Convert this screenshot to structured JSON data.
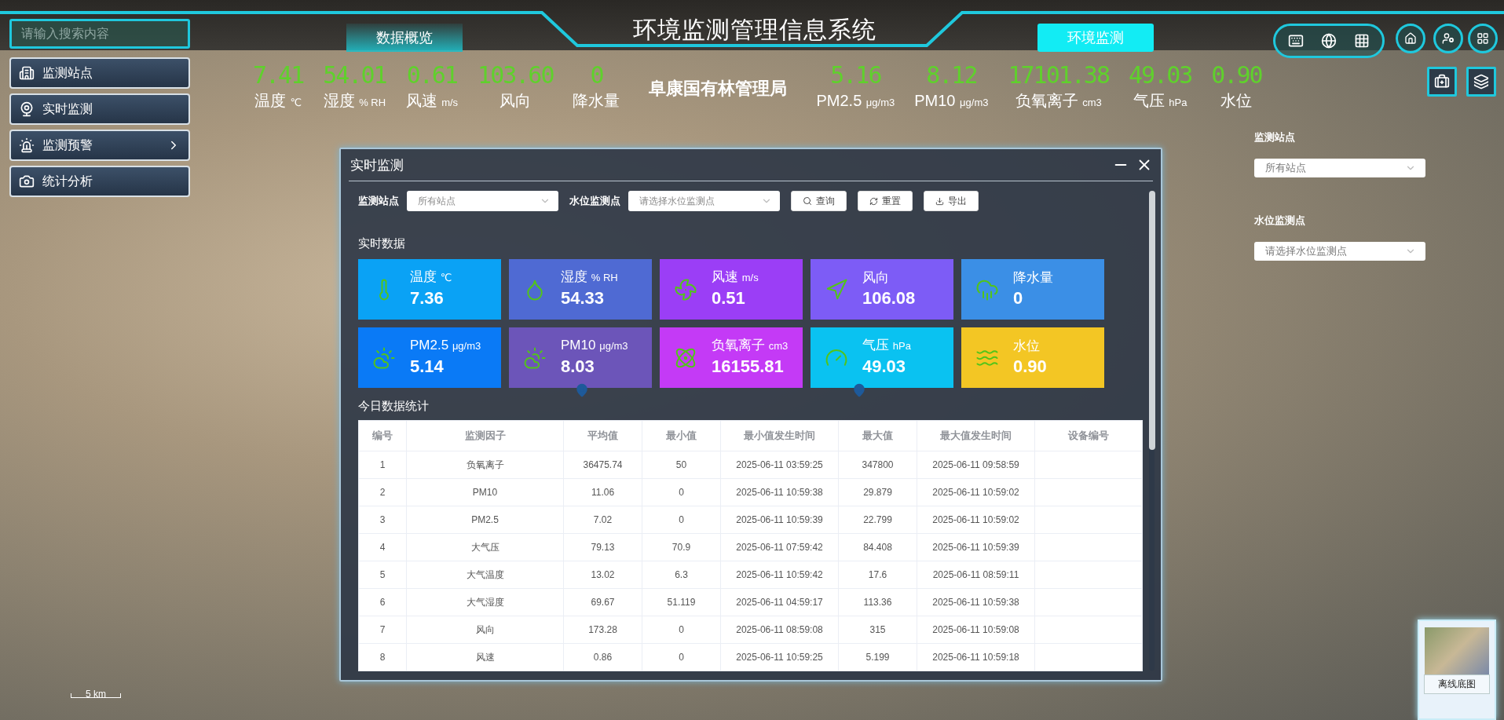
{
  "header": {
    "search": {
      "placeholder": "请输入搜索内容"
    },
    "title": "环境监测管理信息系统",
    "tabs": [
      {
        "label": "数据概览",
        "selected": false
      },
      {
        "label": "环境监测",
        "selected": true
      }
    ]
  },
  "side_menu": [
    {
      "label": "监测站点",
      "expandable": false
    },
    {
      "label": "实时监测",
      "expandable": false
    },
    {
      "label": "监测预警",
      "expandable": true
    },
    {
      "label": "统计分析",
      "expandable": false
    }
  ],
  "metrics_left": [
    {
      "value": "7.41",
      "name": "温度",
      "unit": "℃"
    },
    {
      "value": "54.01",
      "name": "湿度",
      "unit": "% RH"
    },
    {
      "value": "0.61",
      "name": "风速",
      "unit": "m/s"
    },
    {
      "value": "103.60",
      "name": "风向"
    },
    {
      "value": "0",
      "name": "降水量"
    }
  ],
  "organization": "阜康国有林管理局",
  "metrics_right": [
    {
      "value": "5.16",
      "name": "PM2.5",
      "unit": "μg/m3"
    },
    {
      "value": "8.12",
      "name": "PM10",
      "unit": "μg/m3"
    },
    {
      "value": "17101.38",
      "name": "负氧离子",
      "unit": "cm3"
    },
    {
      "value": "49.03",
      "name": "气压",
      "unit": "hPa"
    },
    {
      "value": "0.90",
      "name": "水位"
    }
  ],
  "right_panel": {
    "fields": [
      {
        "label": "监测站点",
        "placeholder": "所有站点"
      },
      {
        "label": "水位监测点",
        "placeholder": "请选择水位监测点"
      }
    ]
  },
  "dialog": {
    "title": "实时监测",
    "filters": [
      {
        "label": "监测站点",
        "placeholder": "所有站点"
      },
      {
        "label": "水位监测点",
        "placeholder": "请选择水位监测点"
      }
    ],
    "buttons": [
      {
        "label": "查询",
        "kind": "search"
      },
      {
        "label": "重置",
        "kind": "reset"
      },
      {
        "label": "导出",
        "kind": "export"
      }
    ],
    "realtime_title": "实时数据",
    "cards": [
      {
        "name": "温度",
        "unit": "℃",
        "value": "7.36",
        "color": "#0aa2f5"
      },
      {
        "name": "湿度",
        "unit": "% RH",
        "value": "54.33",
        "color": "#4f6ad3"
      },
      {
        "name": "风速",
        "unit": "m/s",
        "value": "0.51",
        "color": "#9b3ef6"
      },
      {
        "name": "风向",
        "value": "106.08",
        "color": "#7d5cf6"
      },
      {
        "name": "降水量",
        "value": "0",
        "color": "#3b8fe6"
      },
      {
        "name": "PM2.5",
        "unit": "μg/m3",
        "value": "5.14",
        "color": "#0a7af6"
      },
      {
        "name": "PM10",
        "unit": "μg/m3",
        "value": "8.03",
        "color": "#6c55b9"
      },
      {
        "name": "负氧离子",
        "unit": "cm3",
        "value": "16155.81",
        "color": "#c43af6"
      },
      {
        "name": "气压",
        "unit": "hPa",
        "value": "49.03",
        "color": "#0ac2f1"
      },
      {
        "name": "水位",
        "value": "0.90",
        "color": "#f3c624"
      }
    ],
    "stats_title": "今日数据统计",
    "table": {
      "columns": [
        "编号",
        "监测因子",
        "平均值",
        "最小值",
        "最小值发生时间",
        "最大值",
        "最大值发生时间",
        "设备编号"
      ],
      "rows": [
        [
          "1",
          "负氧离子",
          "36475.74",
          "50",
          "2025-06-11 03:59:25",
          "347800",
          "2025-06-11 09:58:59"
        ],
        [
          "2",
          "PM10",
          "11.06",
          "0",
          "2025-06-11 10:59:38",
          "29.879",
          "2025-06-11 10:59:02"
        ],
        [
          "3",
          "PM2.5",
          "7.02",
          "0",
          "2025-06-11 10:59:39",
          "22.799",
          "2025-06-11 10:59:02"
        ],
        [
          "4",
          "大气压",
          "79.13",
          "70.9",
          "2025-06-11 07:59:42",
          "84.408",
          "2025-06-11 10:59:39"
        ],
        [
          "5",
          "大气温度",
          "13.02",
          "6.3",
          "2025-06-11 10:59:42",
          "17.6",
          "2025-06-11 08:59:11"
        ],
        [
          "6",
          "大气湿度",
          "69.67",
          "51.119",
          "2025-06-11 04:59:17",
          "113.36",
          "2025-06-11 10:59:38"
        ],
        [
          "7",
          "风向",
          "173.28",
          "0",
          "2025-06-11 08:59:08",
          "315",
          "2025-06-11 10:59:08"
        ],
        [
          "8",
          "风速",
          "0.86",
          "0",
          "2025-06-11 10:59:25",
          "5.199",
          "2025-06-11 10:59:18"
        ]
      ]
    }
  },
  "scale": "5 km",
  "basemap": {
    "label": "离线底图"
  }
}
